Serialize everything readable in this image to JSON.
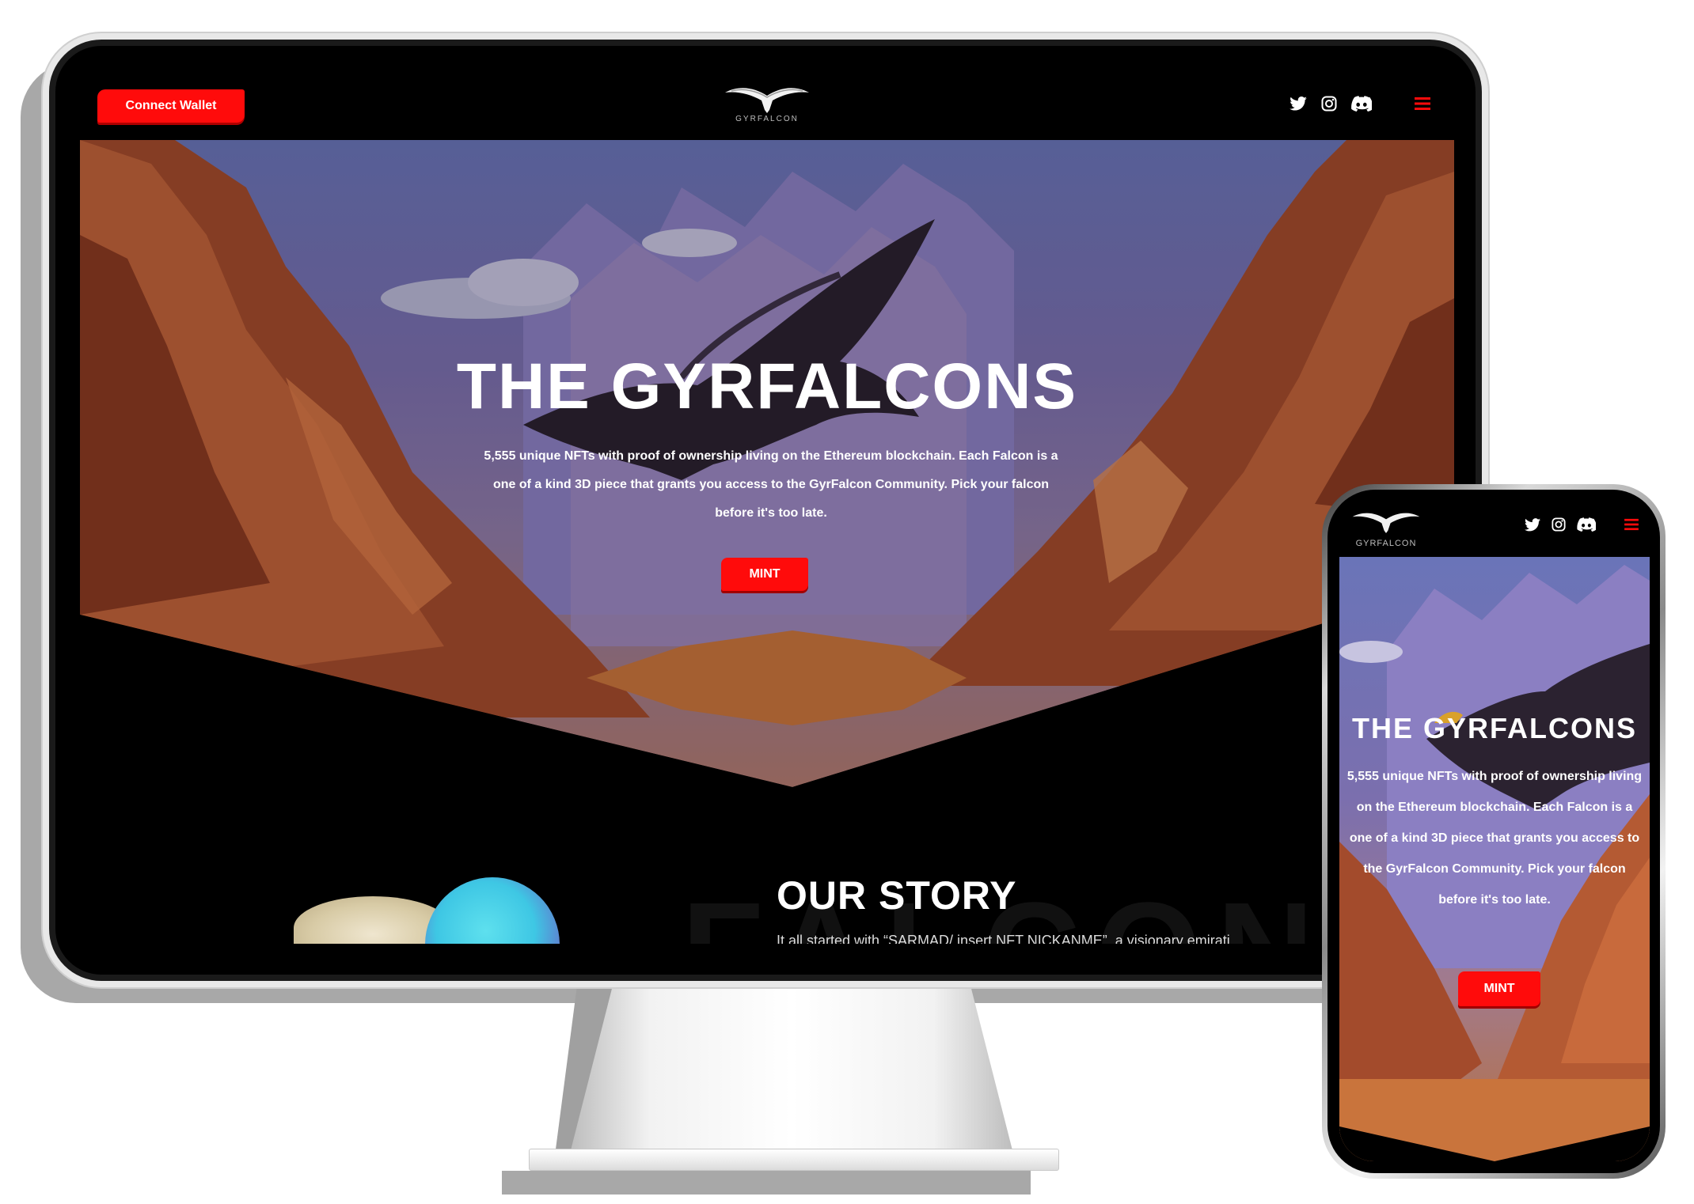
{
  "desktop": {
    "nav": {
      "connect_wallet_label": "Connect Wallet",
      "logo_text": "GYRFALCON",
      "social_icons": [
        "twitter-icon",
        "instagram-icon",
        "discord-icon"
      ],
      "menu_icon": "hamburger-menu-icon"
    },
    "hero": {
      "title": "THE GYRFALCONS",
      "description": "5,555 unique NFTs with proof of ownership living on the Ethereum blockchain. Each Falcon is a one of a kind 3D piece that grants you access to the GyrFalcon Community. Pick your falcon before it's too late.",
      "mint_label": "MINT"
    },
    "story": {
      "title": "OUR STORY",
      "background_word": "FALCON",
      "text": "It all started with “SARMAD/ insert NFT NICKANME”, a visionary emirati"
    }
  },
  "mobile": {
    "nav": {
      "logo_text": "GYRFALCON",
      "social_icons": [
        "twitter-icon",
        "instagram-icon",
        "discord-icon"
      ],
      "menu_icon": "hamburger-menu-icon"
    },
    "hero": {
      "title": "THE GYRFALCONS",
      "description": "5,555 unique NFTs with proof of ownership living on the Ethereum blockchain. Each Falcon is a one of a kind 3D piece that grants you access to the GyrFalcon Community. Pick your falcon before it's too late.",
      "mint_label": "MINT"
    }
  },
  "colors": {
    "accent": "#ff0b0b",
    "background": "#000000",
    "text": "#ffffff"
  }
}
